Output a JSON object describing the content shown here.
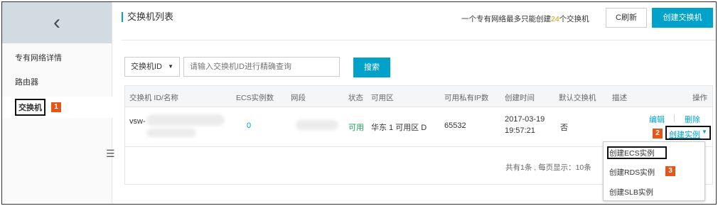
{
  "sidebar": {
    "back_glyph": "‹",
    "items": [
      {
        "label": "专有网络详情"
      },
      {
        "label": "路由器"
      },
      {
        "label": "交换机"
      }
    ],
    "step_badge": "1",
    "collapse_glyph": "☰"
  },
  "header": {
    "title": "交换机列表",
    "note_prefix": "一个专有网络最多只能创建",
    "note_count": "24",
    "note_suffix": "个交换机",
    "refresh_label": "C刷新",
    "create_label": "创建交换机"
  },
  "search": {
    "filter_value": "交换机ID",
    "placeholder": "请输入交换机ID进行精确查询",
    "button_label": "搜索"
  },
  "table": {
    "columns": [
      "交换机 ID/名称",
      "ECS实例数",
      "网段",
      "状态",
      "可用区",
      "可用私有IP数",
      "创建时间",
      "默认交换机",
      "描述",
      "操作"
    ],
    "rows": [
      {
        "id_prefix": "vsw-",
        "ecs_count": "0",
        "status": "可用",
        "zone": "华东 1 可用区 D",
        "available_ips": "65532",
        "created_date": "2017-03-19",
        "created_time": "19:57:21",
        "default": "否",
        "op_edit": "编辑",
        "op_sep": "|",
        "op_delete": "删除",
        "op_create_instance": "创建实例",
        "step_badge": "2"
      }
    ],
    "footer": "共有1条 , 每页显示：10条"
  },
  "dropdown": {
    "items": [
      {
        "label": "创建ECS实例"
      },
      {
        "label": "创建RDS实例"
      },
      {
        "label": "创建SLB实例"
      }
    ],
    "step_badge": "3"
  },
  "colors": {
    "accent": "#00a2ca",
    "badge": "#e4571b",
    "status_ok": "#1aa15f",
    "note_count": "#f39200"
  }
}
